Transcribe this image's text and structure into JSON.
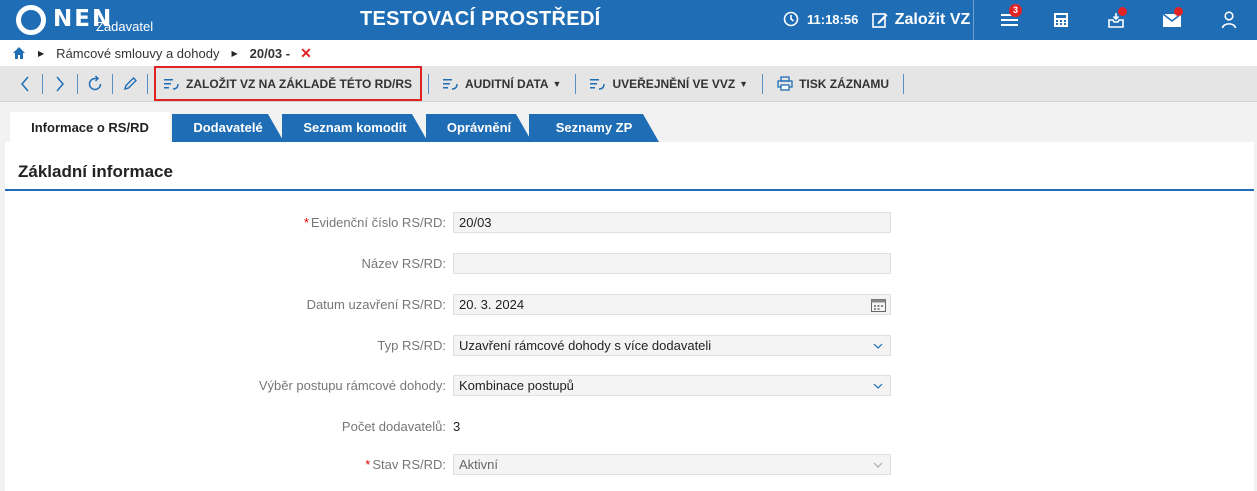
{
  "header": {
    "logo_text": "NEN",
    "logo_sub": "Zadavatel",
    "env_title": "TESTOVACÍ PROSTŘEDÍ",
    "clock": "11:18:56",
    "create_vz_label": "Založit VZ",
    "menu_badge": "3",
    "colors": {
      "bar": "#1f6db5",
      "badge": "#e02424"
    },
    "icons": [
      "clock-icon",
      "edit-icon",
      "menu-icon",
      "calculator-icon",
      "inbox-icon",
      "mail-icon",
      "user-icon"
    ]
  },
  "breadcrumb": {
    "items": [
      "Rámcové smlouvy a dohody"
    ],
    "current": "20/03 -",
    "close": "✕"
  },
  "toolbar": {
    "create_vz_from_rs": "ZALOŽIT VZ NA ZÁKLADĚ TÉTO RD/RS",
    "audit_data": "AUDITNÍ DATA",
    "publish_vvz": "UVEŘEJNĚNÍ VE VVZ",
    "print": "TISK ZÁZNAMU"
  },
  "tabs": [
    {
      "label": "Informace o RS/RD",
      "active": true
    },
    {
      "label": "Dodavatelé"
    },
    {
      "label": "Seznam komodit"
    },
    {
      "label": "Oprávnění"
    },
    {
      "label": "Seznamy ZP"
    }
  ],
  "section": {
    "title": "Základní informace"
  },
  "form": {
    "evidencni_cislo": {
      "label": "Evidenční číslo RS/RD:",
      "value": "20/03",
      "required": "*"
    },
    "nazev": {
      "label": "Název RS/RD:",
      "value": ""
    },
    "datum": {
      "label": "Datum uzavření RS/RD:",
      "value": "20. 3. 2024"
    },
    "typ": {
      "label": "Typ RS/RD:",
      "value": "Uzavření rámcové dohody s více dodavateli"
    },
    "vyber": {
      "label": "Výběr postupu rámcové dohody:",
      "value": "Kombinace postupů"
    },
    "pocet": {
      "label": "Počet dodavatelů:",
      "value": "3"
    },
    "stav": {
      "label": "Stav RS/RD:",
      "value": "Aktivní",
      "required": "*"
    }
  }
}
